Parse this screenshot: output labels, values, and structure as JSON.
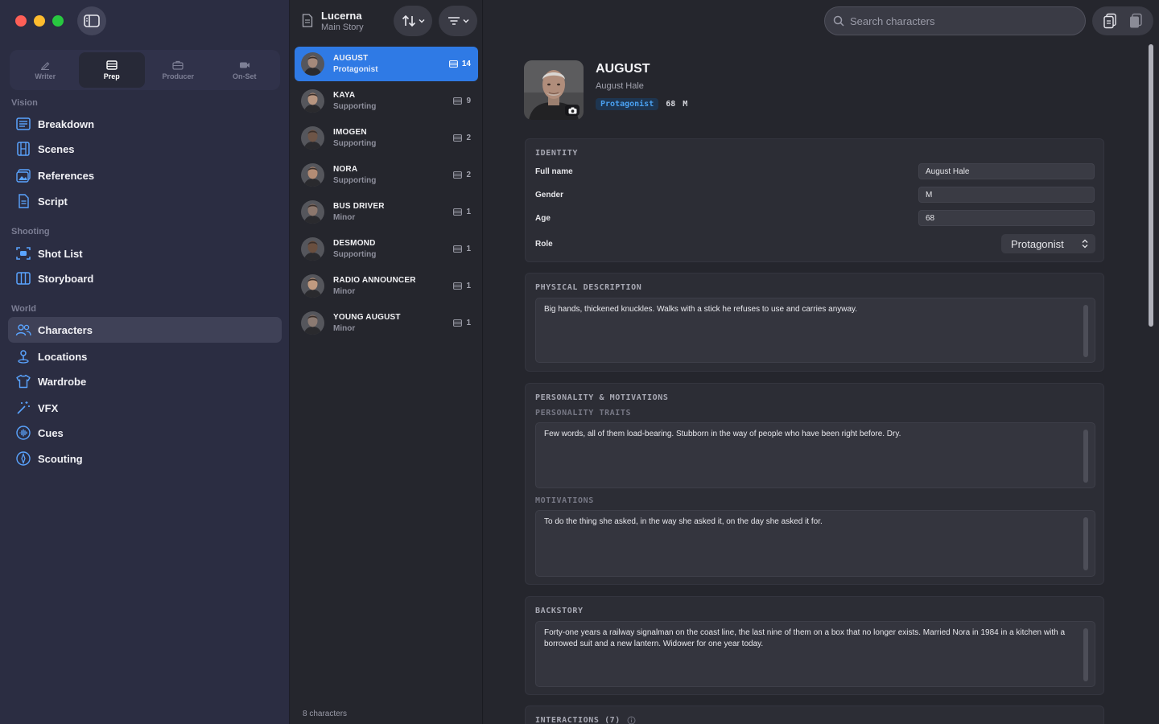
{
  "window": {
    "controls": [
      "close",
      "minimize",
      "zoom"
    ]
  },
  "mode_tabs": [
    {
      "label": "Writer",
      "icon": "pencil-icon",
      "active": false
    },
    {
      "label": "Prep",
      "icon": "film-frame-icon",
      "active": true
    },
    {
      "label": "Producer",
      "icon": "briefcase-icon",
      "active": false
    },
    {
      "label": "On-Set",
      "icon": "video-camera-icon",
      "active": false
    }
  ],
  "sidebar": {
    "sections": [
      {
        "label": "Vision",
        "items": [
          {
            "label": "Breakdown",
            "icon": "list-icon"
          },
          {
            "label": "Scenes",
            "icon": "film-strip-icon"
          },
          {
            "label": "References",
            "icon": "image-stack-icon"
          },
          {
            "label": "Script",
            "icon": "document-icon"
          }
        ]
      },
      {
        "label": "Shooting",
        "items": [
          {
            "label": "Shot List",
            "icon": "camera-frame-icon"
          },
          {
            "label": "Storyboard",
            "icon": "columns-icon"
          }
        ]
      },
      {
        "label": "World",
        "items": [
          {
            "label": "Characters",
            "icon": "people-icon",
            "active": true
          },
          {
            "label": "Locations",
            "icon": "location-pin-icon"
          },
          {
            "label": "Wardrobe",
            "icon": "tshirt-icon"
          },
          {
            "label": "VFX",
            "icon": "magic-wand-icon"
          },
          {
            "label": "Cues",
            "icon": "waveform-icon"
          },
          {
            "label": "Scouting",
            "icon": "compass-icon"
          }
        ]
      }
    ]
  },
  "project": {
    "title": "Lucerna",
    "subtitle": "Main Story"
  },
  "characters": [
    {
      "name": "AUGUST",
      "role": "Protagonist",
      "scenes": "14",
      "active": true,
      "skin": "#a4897b"
    },
    {
      "name": "KAYA",
      "role": "Supporting",
      "scenes": "9",
      "skin": "#b79580"
    },
    {
      "name": "IMOGEN",
      "role": "Supporting",
      "scenes": "2",
      "skin": "#6e5547"
    },
    {
      "name": "NORA",
      "role": "Supporting",
      "scenes": "2",
      "skin": "#b38c75"
    },
    {
      "name": "BUS DRIVER",
      "role": "Minor",
      "scenes": "1",
      "skin": "#8c776d"
    },
    {
      "name": "DESMOND",
      "role": "Supporting",
      "scenes": "1",
      "skin": "#6a4f3f"
    },
    {
      "name": "RADIO ANNOUNCER",
      "role": "Minor",
      "scenes": "1",
      "skin": "#c09a80"
    },
    {
      "name": "YOUNG AUGUST",
      "role": "Minor",
      "scenes": "1",
      "skin": "#8b7a72"
    }
  ],
  "list_footer": "8 characters",
  "search": {
    "placeholder": "Search characters"
  },
  "detail": {
    "name": "AUGUST",
    "full_name": "August Hale",
    "role_tag": "Protagonist",
    "age": "68",
    "gender": "M",
    "identity": {
      "title": "IDENTITY",
      "full_name_label": "Full name",
      "full_name_value": "August Hale",
      "gender_label": "Gender",
      "gender_value": "M",
      "age_label": "Age",
      "age_value": "68",
      "role_label": "Role",
      "role_value": "Protagonist"
    },
    "physical": {
      "title": "PHYSICAL DESCRIPTION",
      "text": "Big hands, thickened knuckles. Walks with a stick he refuses to use and carries anyway."
    },
    "personality": {
      "title": "PERSONALITY & MOTIVATIONS",
      "traits_label": "PERSONALITY TRAITS",
      "traits_text": "Few words, all of them load-bearing. Stubborn in the way of people who have been right before. Dry.",
      "motivations_label": "MOTIVATIONS",
      "motivations_text": "To do the thing she asked, in the way she asked it, on the day she asked it for."
    },
    "backstory": {
      "title": "BACKSTORY",
      "text": "Forty-one years a railway signalman on the coast line, the last nine of them on a box that no longer exists. Married Nora in 1984 in a kitchen with a borrowed suit and a new lantern. Widower for one year today."
    },
    "interactions": {
      "title": "INTERACTIONS (7)"
    }
  },
  "colors": {
    "accent": "#2f7ae5",
    "sidebar_bg": "#2b2d42",
    "pane_bg": "#25262d",
    "card_bg": "#2c2d35",
    "role_chip_text": "#4aa0f0"
  }
}
